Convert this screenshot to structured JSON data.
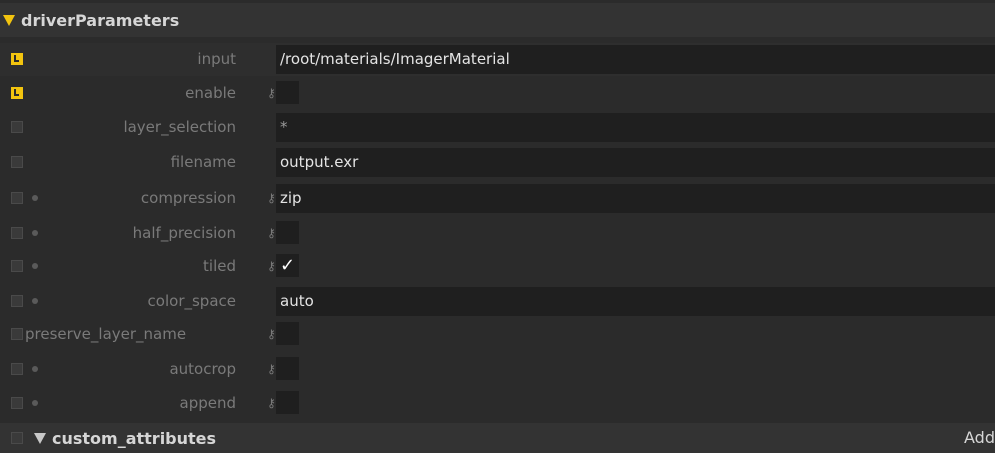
{
  "section": {
    "title": "driverParameters"
  },
  "rows": [
    {
      "label": "input",
      "value": "/root/materials/ImagerMaterial"
    },
    {
      "label": "enable"
    },
    {
      "label": "layer_selection",
      "value": "*"
    },
    {
      "label": "filename",
      "value": "output.exr"
    },
    {
      "label": "compression",
      "value": "zip"
    },
    {
      "label": "half_precision"
    },
    {
      "label": "tiled",
      "value": "✓"
    },
    {
      "label": "color_space",
      "value": "auto"
    },
    {
      "label": "preserve_layer_name"
    },
    {
      "label": "autocrop"
    },
    {
      "label": "append"
    }
  ],
  "custom": {
    "title": "custom_attributes",
    "add_label": "Add"
  },
  "colors": {
    "accent": "#f2c40f",
    "bg": "#2b2b2b",
    "field": "#1f1f1f"
  }
}
